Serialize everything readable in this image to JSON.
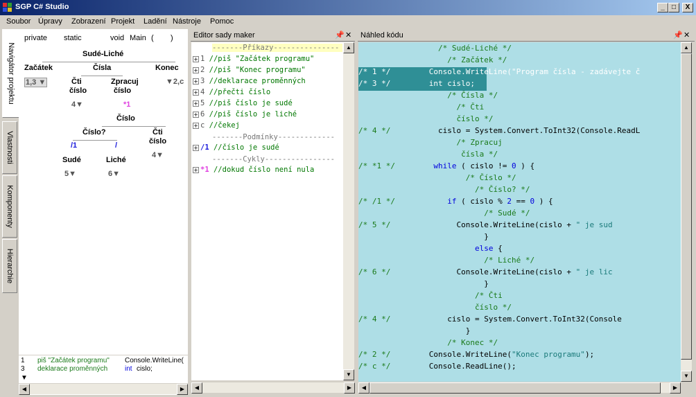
{
  "window": {
    "title": "SGP C# Studio",
    "btn_min": "_",
    "btn_max": "□",
    "btn_close": "X"
  },
  "menu": [
    "Soubor",
    "Úpravy",
    "Zobrazení",
    "Projekt",
    "Ladění",
    "Nástroje",
    "Pomoc"
  ],
  "vtabs": [
    "Navigátor projektu",
    "Vlastnosti",
    "Komponenty",
    "Hierarchie"
  ],
  "navigator": {
    "header": [
      "private",
      "static",
      "void",
      "Main",
      "(",
      ")"
    ],
    "root": "Sudé-Liché",
    "zacatek": "Začátek",
    "zacatek_badge": "1,3",
    "cisla": "Čísla",
    "konec": "Konec",
    "konec_badge": "2,c",
    "cti1": "Čti",
    "cti1b": "číslo",
    "cti1_badge": "4",
    "zpracuj": "Zpracuj",
    "zpracujb": "číslo",
    "zpracuj_badge": "*1",
    "cislo": "Číslo",
    "cislo_q": "Číslo?",
    "cti2": "Čti",
    "cti2b": "číslo",
    "cti2_badge": "4",
    "if_badge": "/1",
    "else_badge": "/",
    "sude": "Sudé",
    "sude_badge": "5",
    "liche": "Liché",
    "liche_badge": "6",
    "bottom": [
      {
        "n": "1",
        "txt": "piš \"Začátek programu\"",
        "code": "Console.WriteLine("
      },
      {
        "n": "3",
        "txt": "deklarace proměnných",
        "kw": "int",
        "code": " cislo;"
      }
    ]
  },
  "editor": {
    "title": "Editor sady maker",
    "sep_prikazy": "-------Příkazy---------------",
    "rows": [
      {
        "n": "1",
        "t": "//piš \"Začátek programu\""
      },
      {
        "n": "2",
        "t": "//piš \"Konec programu\""
      },
      {
        "n": "3",
        "t": "//deklarace proměnných"
      },
      {
        "n": "4",
        "t": "//přečti číslo"
      },
      {
        "n": "5",
        "t": "//piš číslo je sudé"
      },
      {
        "n": "6",
        "t": "//piš číslo je liché"
      },
      {
        "n": "c",
        "t": "//čekej"
      }
    ],
    "sep_podminky": "-------Podmínky-------------",
    "cond": {
      "n": "/1",
      "t": "//číslo je sudé"
    },
    "sep_cykly": "-------Cykly----------------",
    "loop": {
      "n": "*1",
      "t": "//dokud číslo není nula"
    }
  },
  "code": {
    "title": "Náhled kódu",
    "lines": [
      {
        "tag": "",
        "ind": "        ",
        "parts": [
          [
            "g",
            "/* Sudé-Liché */"
          ]
        ]
      },
      {
        "tag": "",
        "ind": "          ",
        "parts": [
          [
            "g",
            "/* Začátek */"
          ]
        ]
      },
      {
        "tag": "/* 1 */",
        "ind": "      ",
        "hl": true,
        "parts": [
          [
            "",
            "Console.WriteLine("
          ],
          [
            "s",
            "\"Program čísla - zadávejte č"
          ]
        ]
      },
      {
        "tag": "/* 3 */",
        "ind": "      ",
        "hl": true,
        "parts": [
          [
            "k",
            "int"
          ],
          [
            "",
            " cislo;"
          ]
        ]
      },
      {
        "tag": "",
        "ind": "          ",
        "parts": [
          [
            "g",
            "/* Čísla */"
          ]
        ]
      },
      {
        "tag": "",
        "ind": "            ",
        "parts": [
          [
            "g",
            "/* Čti"
          ]
        ]
      },
      {
        "tag": "",
        "ind": "            ",
        "parts": [
          [
            "g",
            "číslo */"
          ]
        ]
      },
      {
        "tag": "/* 4 */",
        "ind": "        ",
        "parts": [
          [
            "",
            "cislo = System.Convert.ToInt32(Console.ReadL"
          ]
        ]
      },
      {
        "tag": "",
        "ind": "            ",
        "parts": [
          [
            "g",
            "/* Zpracuj"
          ]
        ]
      },
      {
        "tag": "",
        "ind": "             ",
        "parts": [
          [
            "g",
            "čísla */"
          ]
        ]
      },
      {
        "tag": "/* *1 */",
        "ind": "       ",
        "parts": [
          [
            "k",
            "while"
          ],
          [
            "",
            " ( cislo != "
          ],
          [
            "k",
            "0"
          ],
          [
            "",
            " ) {"
          ]
        ]
      },
      {
        "tag": "",
        "ind": "              ",
        "parts": [
          [
            "g",
            "/* Číslo */"
          ]
        ]
      },
      {
        "tag": "",
        "ind": "                ",
        "parts": [
          [
            "g",
            "/* Číslo? */"
          ]
        ]
      },
      {
        "tag": "/* /1 */",
        "ind": "          ",
        "parts": [
          [
            "k",
            "if"
          ],
          [
            "",
            " ( cislo % "
          ],
          [
            "k",
            "2"
          ],
          [
            "",
            " == "
          ],
          [
            "k",
            "0"
          ],
          [
            "",
            " ) {"
          ]
        ]
      },
      {
        "tag": "",
        "ind": "                  ",
        "parts": [
          [
            "g",
            "/* Sudé */"
          ]
        ]
      },
      {
        "tag": "/* 5 */",
        "ind": "            ",
        "parts": [
          [
            "",
            "Console.WriteLine(cislo + "
          ],
          [
            "s",
            "\" je sud"
          ]
        ]
      },
      {
        "tag": "",
        "ind": "                  ",
        "parts": [
          [
            "",
            "}"
          ]
        ]
      },
      {
        "tag": "",
        "ind": "                ",
        "parts": [
          [
            "k",
            "else"
          ],
          [
            "",
            " {"
          ]
        ]
      },
      {
        "tag": "",
        "ind": "                  ",
        "parts": [
          [
            "g",
            "/* Liché */"
          ]
        ]
      },
      {
        "tag": "/* 6 */",
        "ind": "            ",
        "parts": [
          [
            "",
            "Console.WriteLine(cislo + "
          ],
          [
            "s",
            "\" je lic"
          ]
        ]
      },
      {
        "tag": "",
        "ind": "                  ",
        "parts": [
          [
            "",
            "}"
          ]
        ]
      },
      {
        "tag": "",
        "ind": "                ",
        "parts": [
          [
            "g",
            "/* Čti"
          ]
        ]
      },
      {
        "tag": "",
        "ind": "                ",
        "parts": [
          [
            "g",
            "číslo */"
          ]
        ]
      },
      {
        "tag": "/* 4 */",
        "ind": "          ",
        "parts": [
          [
            "",
            "cislo = System.Convert.ToInt32(Console"
          ]
        ]
      },
      {
        "tag": "",
        "ind": "              ",
        "parts": [
          [
            "",
            "}"
          ]
        ]
      },
      {
        "tag": "",
        "ind": "          ",
        "parts": [
          [
            "g",
            "/* Konec */"
          ]
        ]
      },
      {
        "tag": "/* 2 */",
        "ind": "      ",
        "parts": [
          [
            "",
            "Console.WriteLine("
          ],
          [
            "s",
            "\"Konec programu\""
          ],
          [
            "",
            ");"
          ]
        ]
      },
      {
        "tag": "/* c */",
        "ind": "      ",
        "parts": [
          [
            "",
            "Console.ReadLine();"
          ]
        ]
      }
    ]
  }
}
